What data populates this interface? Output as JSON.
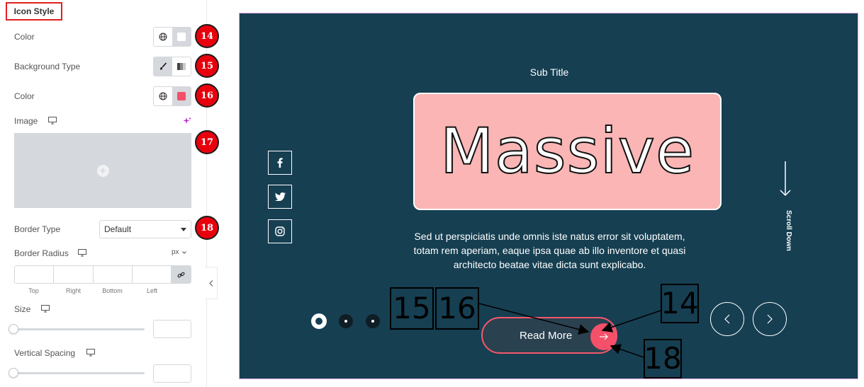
{
  "panel": {
    "section_title": "Icon Style",
    "rows": {
      "color1": "Color",
      "bg_type": "Background Type",
      "color2": "Color",
      "image": "Image",
      "border_type": "Border Type",
      "border_radius": "Border Radius",
      "size": "Size",
      "vertical_spacing": "Vertical Spacing"
    },
    "border_type_value": "Default",
    "unit": "px",
    "dims": [
      "Top",
      "Right",
      "Bottom",
      "Left"
    ],
    "badges": [
      "14",
      "15",
      "16",
      "17",
      "18"
    ],
    "colors": {
      "swatch1": "#ffffff",
      "swatch2": "#f4506a",
      "badge": "#e8000c"
    }
  },
  "preview": {
    "sub_title": "Sub Title",
    "title": "Massive",
    "description": "Sed ut perspiciatis unde omnis iste natus error sit voluptatem, totam rem aperiam, eaque ipsa quae ab illo inventore et quasi architecto beatae vitae dicta sunt explicabo.",
    "scroll_label": "Scroll Down",
    "button_label": "Read More",
    "social": [
      "facebook-icon",
      "twitter-icon",
      "instagram-icon"
    ],
    "colors": {
      "background": "#163f52",
      "title_box": "#fbb5b5",
      "accent": "#f4506a"
    }
  },
  "annotations": [
    "15",
    "16",
    "14",
    "18"
  ]
}
